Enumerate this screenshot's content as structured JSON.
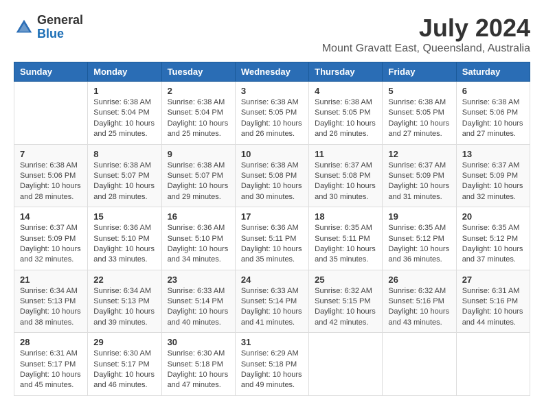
{
  "header": {
    "logo_line1": "General",
    "logo_line2": "Blue",
    "title": "July 2024",
    "subtitle": "Mount Gravatt East, Queensland, Australia"
  },
  "weekdays": [
    "Sunday",
    "Monday",
    "Tuesday",
    "Wednesday",
    "Thursday",
    "Friday",
    "Saturday"
  ],
  "weeks": [
    [
      {
        "day": "",
        "info": ""
      },
      {
        "day": "1",
        "info": "Sunrise: 6:38 AM\nSunset: 5:04 PM\nDaylight: 10 hours\nand 25 minutes."
      },
      {
        "day": "2",
        "info": "Sunrise: 6:38 AM\nSunset: 5:04 PM\nDaylight: 10 hours\nand 25 minutes."
      },
      {
        "day": "3",
        "info": "Sunrise: 6:38 AM\nSunset: 5:05 PM\nDaylight: 10 hours\nand 26 minutes."
      },
      {
        "day": "4",
        "info": "Sunrise: 6:38 AM\nSunset: 5:05 PM\nDaylight: 10 hours\nand 26 minutes."
      },
      {
        "day": "5",
        "info": "Sunrise: 6:38 AM\nSunset: 5:05 PM\nDaylight: 10 hours\nand 27 minutes."
      },
      {
        "day": "6",
        "info": "Sunrise: 6:38 AM\nSunset: 5:06 PM\nDaylight: 10 hours\nand 27 minutes."
      }
    ],
    [
      {
        "day": "7",
        "info": "Sunrise: 6:38 AM\nSunset: 5:06 PM\nDaylight: 10 hours\nand 28 minutes."
      },
      {
        "day": "8",
        "info": "Sunrise: 6:38 AM\nSunset: 5:07 PM\nDaylight: 10 hours\nand 28 minutes."
      },
      {
        "day": "9",
        "info": "Sunrise: 6:38 AM\nSunset: 5:07 PM\nDaylight: 10 hours\nand 29 minutes."
      },
      {
        "day": "10",
        "info": "Sunrise: 6:38 AM\nSunset: 5:08 PM\nDaylight: 10 hours\nand 30 minutes."
      },
      {
        "day": "11",
        "info": "Sunrise: 6:37 AM\nSunset: 5:08 PM\nDaylight: 10 hours\nand 30 minutes."
      },
      {
        "day": "12",
        "info": "Sunrise: 6:37 AM\nSunset: 5:09 PM\nDaylight: 10 hours\nand 31 minutes."
      },
      {
        "day": "13",
        "info": "Sunrise: 6:37 AM\nSunset: 5:09 PM\nDaylight: 10 hours\nand 32 minutes."
      }
    ],
    [
      {
        "day": "14",
        "info": "Sunrise: 6:37 AM\nSunset: 5:09 PM\nDaylight: 10 hours\nand 32 minutes."
      },
      {
        "day": "15",
        "info": "Sunrise: 6:36 AM\nSunset: 5:10 PM\nDaylight: 10 hours\nand 33 minutes."
      },
      {
        "day": "16",
        "info": "Sunrise: 6:36 AM\nSunset: 5:10 PM\nDaylight: 10 hours\nand 34 minutes."
      },
      {
        "day": "17",
        "info": "Sunrise: 6:36 AM\nSunset: 5:11 PM\nDaylight: 10 hours\nand 35 minutes."
      },
      {
        "day": "18",
        "info": "Sunrise: 6:35 AM\nSunset: 5:11 PM\nDaylight: 10 hours\nand 35 minutes."
      },
      {
        "day": "19",
        "info": "Sunrise: 6:35 AM\nSunset: 5:12 PM\nDaylight: 10 hours\nand 36 minutes."
      },
      {
        "day": "20",
        "info": "Sunrise: 6:35 AM\nSunset: 5:12 PM\nDaylight: 10 hours\nand 37 minutes."
      }
    ],
    [
      {
        "day": "21",
        "info": "Sunrise: 6:34 AM\nSunset: 5:13 PM\nDaylight: 10 hours\nand 38 minutes."
      },
      {
        "day": "22",
        "info": "Sunrise: 6:34 AM\nSunset: 5:13 PM\nDaylight: 10 hours\nand 39 minutes."
      },
      {
        "day": "23",
        "info": "Sunrise: 6:33 AM\nSunset: 5:14 PM\nDaylight: 10 hours\nand 40 minutes."
      },
      {
        "day": "24",
        "info": "Sunrise: 6:33 AM\nSunset: 5:14 PM\nDaylight: 10 hours\nand 41 minutes."
      },
      {
        "day": "25",
        "info": "Sunrise: 6:32 AM\nSunset: 5:15 PM\nDaylight: 10 hours\nand 42 minutes."
      },
      {
        "day": "26",
        "info": "Sunrise: 6:32 AM\nSunset: 5:16 PM\nDaylight: 10 hours\nand 43 minutes."
      },
      {
        "day": "27",
        "info": "Sunrise: 6:31 AM\nSunset: 5:16 PM\nDaylight: 10 hours\nand 44 minutes."
      }
    ],
    [
      {
        "day": "28",
        "info": "Sunrise: 6:31 AM\nSunset: 5:17 PM\nDaylight: 10 hours\nand 45 minutes."
      },
      {
        "day": "29",
        "info": "Sunrise: 6:30 AM\nSunset: 5:17 PM\nDaylight: 10 hours\nand 46 minutes."
      },
      {
        "day": "30",
        "info": "Sunrise: 6:30 AM\nSunset: 5:18 PM\nDaylight: 10 hours\nand 47 minutes."
      },
      {
        "day": "31",
        "info": "Sunrise: 6:29 AM\nSunset: 5:18 PM\nDaylight: 10 hours\nand 49 minutes."
      },
      {
        "day": "",
        "info": ""
      },
      {
        "day": "",
        "info": ""
      },
      {
        "day": "",
        "info": ""
      }
    ]
  ]
}
